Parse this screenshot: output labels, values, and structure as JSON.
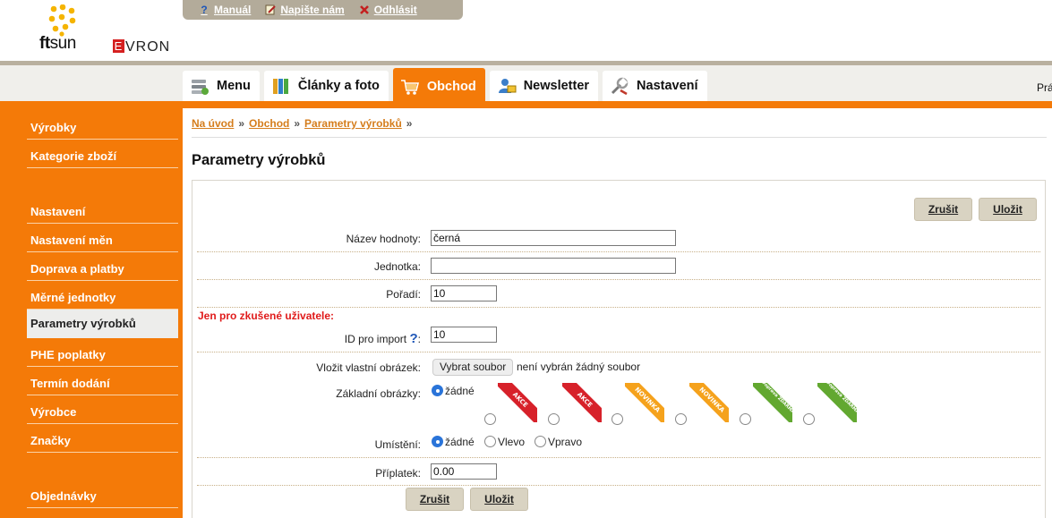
{
  "logo": {
    "ftsun_bold": "ft",
    "ftsun_light": "sun",
    "evron_first": "E",
    "evron_rest": "VRON"
  },
  "toplinks": [
    {
      "label": "Manuál",
      "icon": "help-icon"
    },
    {
      "label": "Napište nám",
      "icon": "note-icon"
    },
    {
      "label": "Odhlásit",
      "icon": "close-icon"
    }
  ],
  "tabs": [
    {
      "label": "Menu",
      "icon": "menu-icon"
    },
    {
      "label": "Články a foto",
      "icon": "articles-icon"
    },
    {
      "label": "Obchod",
      "icon": "cart-icon",
      "active": true
    },
    {
      "label": "Newsletter",
      "icon": "newsletter-icon"
    },
    {
      "label": "Nastavení",
      "icon": "tools-icon"
    }
  ],
  "nav_right": "Prá",
  "sidebar": [
    {
      "label": "Výrobky"
    },
    {
      "label": "Kategorie zboží"
    },
    {
      "label": "Nastavení"
    },
    {
      "label": "Nastavení měn"
    },
    {
      "label": "Doprava a platby"
    },
    {
      "label": "Měrné jednotky"
    },
    {
      "label": "Parametry výrobků",
      "active": true
    },
    {
      "label": "PHE poplatky"
    },
    {
      "label": "Termín dodání"
    },
    {
      "label": "Výrobce"
    },
    {
      "label": "Značky"
    },
    {
      "label": "Objednávky"
    }
  ],
  "breadcrumb": {
    "home": "Na úvod",
    "shop": "Obchod",
    "current": "Parametry výrobků",
    "sep": "»"
  },
  "page_title": "Parametry výrobků",
  "buttons": {
    "cancel": "Zrušit",
    "save": "Uložit"
  },
  "form": {
    "value_name_label": "Název hodnoty:",
    "value_name": "černá",
    "unit_label": "Jednotka:",
    "unit": "",
    "order_label": "Pořadí:",
    "order": "10",
    "expert_warning": "Jen pro zkušené uživatele:",
    "import_id_label": "ID pro import",
    "import_id_suffix": ":",
    "import_id_help": "?",
    "import_id": "10",
    "custom_image_label": "Vložit vlastní obrázek:",
    "file_button": "Vybrat soubor",
    "file_status": "není vybrán žádný soubor",
    "base_images_label": "Základní obrázky:",
    "base_images_none": "žádné",
    "base_images": [
      {
        "text": "AKCE",
        "color": "#d7212a"
      },
      {
        "text": "AKCE",
        "color": "#d7212a"
      },
      {
        "text": "NOVINKA",
        "color": "#f5a21c"
      },
      {
        "text": "NOVINKA",
        "color": "#f5a21c"
      },
      {
        "text": "Doprava ZDARMA",
        "color": "#62a830"
      },
      {
        "text": "Doprava ZDARMA",
        "color": "#62a830"
      }
    ],
    "placement_label": "Umístění:",
    "placement_options": [
      "žádné",
      "Vlevo",
      "Vpravo"
    ],
    "placement_selected": "žádné",
    "surcharge_label": "Příplatek:",
    "surcharge": "0.00"
  },
  "colors": {
    "orange": "#f47a08",
    "tan": "#b3ab9a",
    "link": "#d57d1c",
    "warning": "#e01b1b"
  }
}
